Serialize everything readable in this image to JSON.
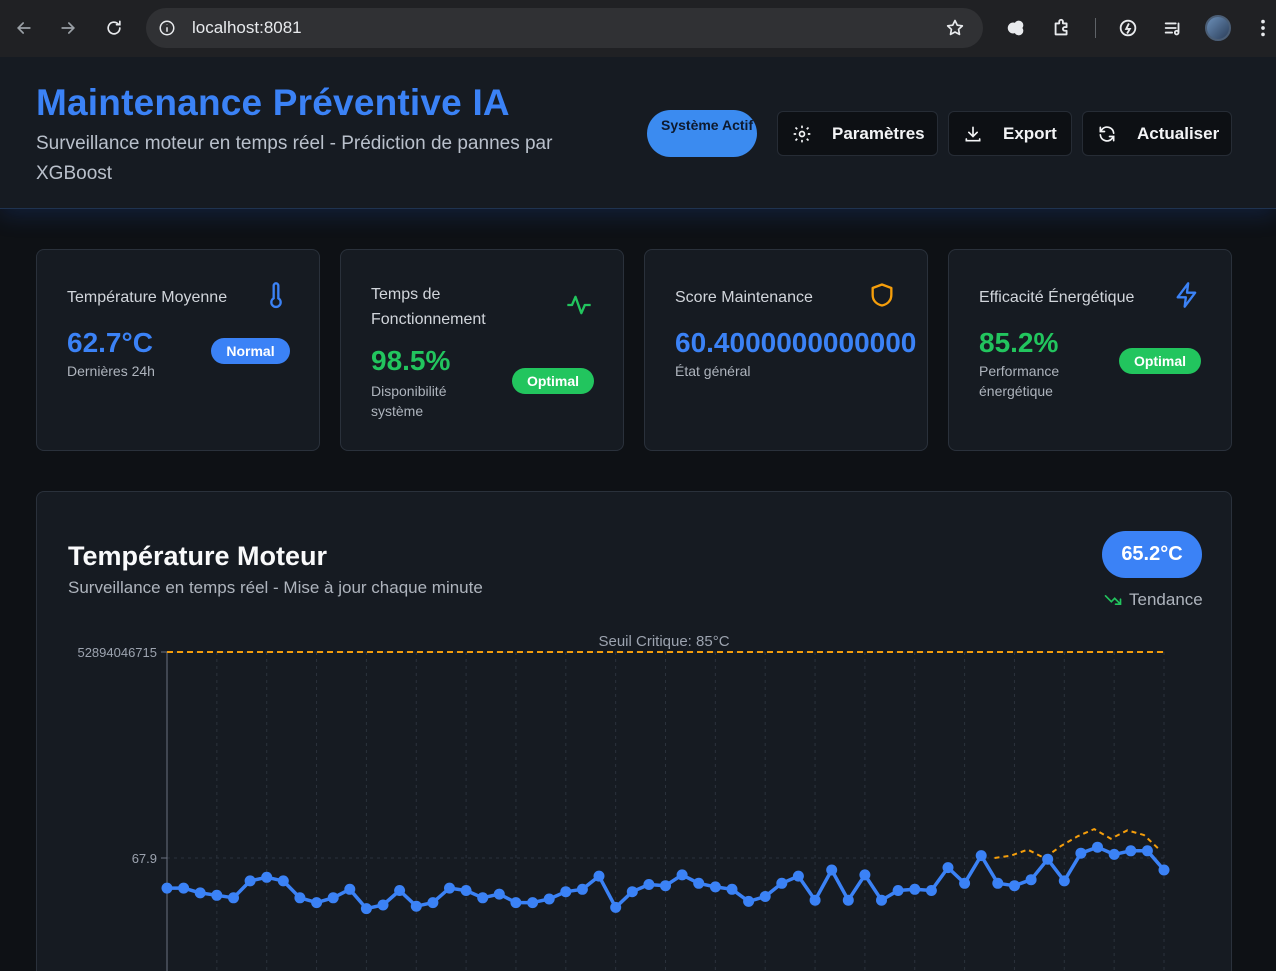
{
  "browser": {
    "url": "localhost:8081"
  },
  "header": {
    "title": "Maintenance Préventive IA",
    "subtitle": "Surveillance moteur en temps réel - Prédiction de pannes par XGBoost",
    "status": "Système Actif",
    "buttons": {
      "settings": "Paramètres",
      "export": "Export",
      "refresh": "Actualiser"
    }
  },
  "kpis": [
    {
      "label": "Température Moyenne",
      "value": "62.7°C",
      "sub": "Dernières 24h",
      "badge": "Normal",
      "color": "#3b82f6",
      "icon": "thermometer-icon"
    },
    {
      "label": "Temps de Fonctionnement",
      "value": "98.5%",
      "sub": "Disponibilité système",
      "badge": "Optimal",
      "color": "#22c55e",
      "icon": "activity-icon"
    },
    {
      "label": "Score Maintenance",
      "value": "60.4000000000000",
      "sub": "État général",
      "badge": "",
      "color": "#3b82f6",
      "icon": "shield-icon"
    },
    {
      "label": "Efficacité Énergétique",
      "value": "85.2%",
      "sub": "Performance énergétique",
      "badge": "Optimal",
      "color": "#22c55e",
      "icon": "zap-icon"
    }
  ],
  "panel": {
    "title": "Température Moteur",
    "subtitle": "Surveillance en temps réel - Mise à jour chaque minute",
    "current": "65.2°C",
    "trend": "Tendance"
  },
  "chart_data": {
    "type": "line",
    "threshold_label": "Seuil Critique: 85°C",
    "y_tick_labels": [
      "52894046715",
      "67.9"
    ],
    "y_tick_values": [
      85,
      67.9
    ],
    "ylim": [
      61.5,
      85
    ],
    "grid": true,
    "colors": {
      "actual": "#3b82f6",
      "prediction": "#f59e0b",
      "threshold": "#f59e0b"
    },
    "series": [
      {
        "values": [
          65.4,
          65.4,
          65.0,
          64.8,
          64.6,
          66.0,
          66.3,
          66.0,
          64.6,
          64.2,
          64.6,
          65.3,
          63.7,
          64.0,
          65.2,
          63.9,
          64.2,
          65.4,
          65.2,
          64.6,
          64.9,
          64.2,
          64.2,
          64.5,
          65.1,
          65.3,
          66.4,
          63.8,
          65.1,
          65.7,
          65.6,
          66.5,
          65.8,
          65.5,
          65.3,
          64.3,
          64.7,
          65.8,
          66.4,
          64.4,
          66.9,
          64.4,
          66.5,
          64.4,
          65.2,
          65.3,
          65.2,
          67.1,
          65.8,
          68.1,
          65.8,
          65.6,
          66.1,
          67.8,
          66.0,
          68.3,
          68.8,
          68.2,
          68.5,
          68.5,
          66.9
        ]
      },
      {
        "values": [
          67.9,
          68.1,
          68.6,
          67.9,
          68.9,
          69.7,
          70.3,
          69.5,
          70.2,
          69.8,
          68.5
        ]
      }
    ]
  }
}
